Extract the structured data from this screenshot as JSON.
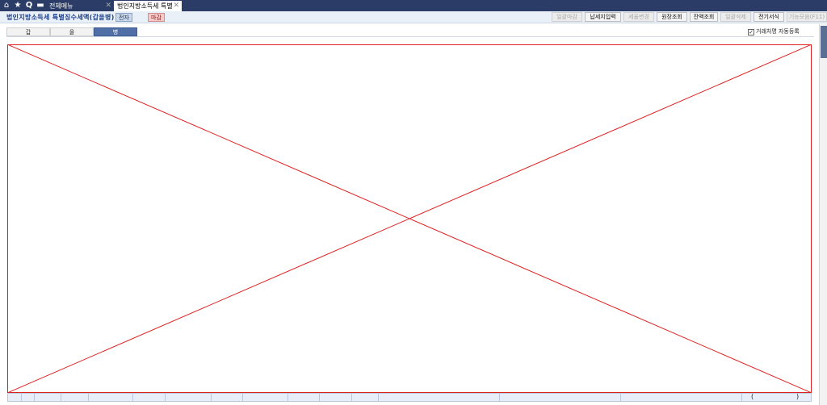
{
  "topbar": {
    "icons": [
      "home-icon",
      "star-icon",
      "search-icon",
      "window-icon"
    ],
    "tabs": [
      {
        "label": "전체메뉴",
        "active": false
      },
      {
        "label": "법인지방소득세 특별",
        "active": true
      }
    ]
  },
  "toolbar": {
    "title": "법인지방소득세 특별징수세액(갑을병)",
    "badges": [
      "전자",
      "마감"
    ],
    "buttons": [
      {
        "label": "일괄마감",
        "enabled": false
      },
      {
        "label": "납세지입력",
        "enabled": true
      },
      {
        "label": "세율변경",
        "enabled": false
      },
      {
        "label": "원장조회",
        "enabled": true
      },
      {
        "label": "잔액조회",
        "enabled": true
      },
      {
        "label": "일괄삭제",
        "enabled": false
      },
      {
        "label": "전기서식",
        "enabled": true
      },
      {
        "label": "기능모음(F11)",
        "enabled": false
      }
    ]
  },
  "subtabs": [
    {
      "label": "갑",
      "selected": false
    },
    {
      "label": "을",
      "selected": false
    },
    {
      "label": "병",
      "selected": true
    }
  ],
  "options": {
    "auto_register_label": "거래처명 자동등록",
    "auto_register_checked": true
  },
  "status_bar": {
    "paren_open": "(",
    "paren_close": ")"
  },
  "colors": {
    "topbar": "#2b3d66",
    "placeholder_line": "#e02020",
    "selected_tab": "#4f6fa6"
  }
}
